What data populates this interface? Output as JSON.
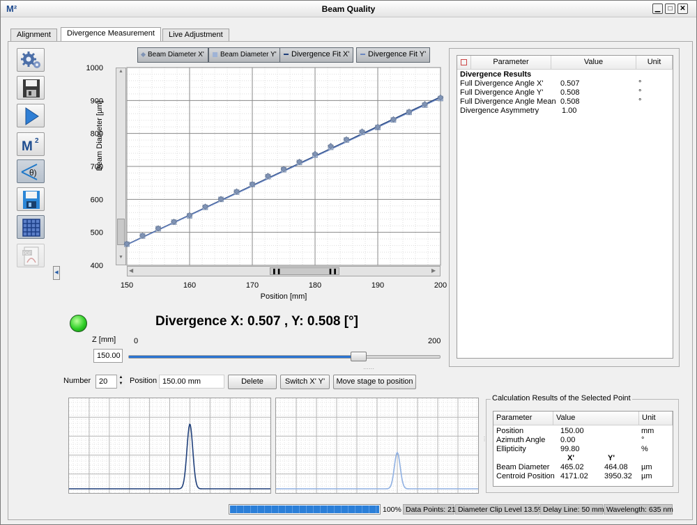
{
  "window": {
    "app_icon": "M²",
    "title": "Beam Quality",
    "buttons": [
      "minimize",
      "maximize",
      "close"
    ]
  },
  "tabs": [
    {
      "label": "Alignment",
      "active": false
    },
    {
      "label": "Divergence Measurement",
      "active": true
    },
    {
      "label": "Live Adjustment",
      "active": false
    }
  ],
  "toolbar": [
    {
      "icon": "settings-gear-icon"
    },
    {
      "icon": "load-disk-icon"
    },
    {
      "icon": "play-icon"
    },
    {
      "icon": "m2-icon",
      "label": "M²"
    },
    {
      "icon": "divergence-theta-icon",
      "label": "θ)",
      "pressed": true
    },
    {
      "icon": "save-disk-icon"
    },
    {
      "icon": "grid-table-icon",
      "pressed": true
    },
    {
      "icon": "pdf-export-icon",
      "label": "PDF",
      "disabled": true
    }
  ],
  "legend": [
    {
      "label": "Beam Diameter X'",
      "color": "#7f93b5",
      "marker": "diamond"
    },
    {
      "label": "Beam Diameter Y'",
      "color": "#9fb3d6",
      "marker": "square"
    },
    {
      "label": "Divergence Fit X'",
      "color": "#1f3f7a",
      "marker": "line"
    },
    {
      "label": "Divergence Fit Y'",
      "color": "#6b87c0",
      "marker": "line"
    }
  ],
  "chart_data": {
    "type": "scatter",
    "xlabel": "Position [mm]",
    "ylabel": "Beam Diameter [µm]",
    "xlim": [
      150,
      200
    ],
    "ylim": [
      400,
      1000
    ],
    "xticks": [
      150,
      160,
      170,
      180,
      190,
      200
    ],
    "yticks": [
      400,
      500,
      600,
      700,
      800,
      900,
      1000
    ],
    "grid": true,
    "series": [
      {
        "name": "Beam Diameter X'",
        "x": [
          150,
          152.5,
          155,
          157.5,
          160,
          162.5,
          165,
          167.5,
          170,
          172.5,
          175,
          177.5,
          180,
          182.5,
          185,
          187.5,
          190,
          192.5,
          195,
          197.5,
          200
        ],
        "values": [
          465,
          490,
          512,
          532,
          552,
          578,
          601,
          624,
          646,
          671,
          692,
          714,
          738,
          762,
          782,
          806,
          820,
          843,
          866,
          889,
          909
        ]
      },
      {
        "name": "Beam Diameter Y'",
        "x": [
          150,
          152.5,
          155,
          157.5,
          160,
          162.5,
          165,
          167.5,
          170,
          172.5,
          175,
          177.5,
          180,
          182.5,
          185,
          187.5,
          190,
          192.5,
          195,
          197.5,
          200
        ],
        "values": [
          464,
          489,
          511,
          531,
          550,
          576,
          600,
          622,
          645,
          669,
          690,
          712,
          734,
          758,
          780,
          803,
          818,
          841,
          864,
          886,
          906
        ]
      },
      {
        "name": "Divergence Fit X'",
        "x": [
          150,
          200
        ],
        "values": [
          463,
          911
        ]
      },
      {
        "name": "Divergence Fit Y'",
        "x": [
          150,
          200
        ],
        "values": [
          462,
          908
        ]
      }
    ]
  },
  "result_headline": "Divergence X: 0.507 , Y: 0.508 [°]",
  "status_led_color": "#2fcf27",
  "z_control": {
    "label": "Z [mm]",
    "value": "150.00",
    "min_label": "0",
    "max_label": "200",
    "fraction": 0.74
  },
  "results_table": {
    "headers": [
      "Parameter",
      "Value",
      "Unit"
    ],
    "section": "Divergence Results",
    "rows": [
      {
        "param": "Full Divergence Angle X'",
        "value": "0.507",
        "unit": "°"
      },
      {
        "param": "Full Divergence Angle Y'",
        "value": "0.508",
        "unit": "°"
      },
      {
        "param": "Full Divergence Angle Mean",
        "value": "0.508",
        "unit": "°"
      },
      {
        "param": "Divergence Asymmetry",
        "value": "1.00",
        "unit": ""
      }
    ]
  },
  "controls": {
    "number_label": "Number",
    "number_value": "20",
    "position_label": "Position",
    "position_value": "150.00 mm",
    "delete_label": "Delete",
    "switch_label": "Switch X' Y'",
    "move_label": "Move stage to position"
  },
  "profiles": [
    {
      "name": "X' profile",
      "color": "#1f3f7a",
      "peak_pos": 0.6,
      "peak_height": 0.75
    },
    {
      "name": "Y' profile",
      "color": "#8fb0e2",
      "peak_pos": 0.6,
      "peak_height": 0.42
    }
  ],
  "selected_point": {
    "group_title": "Calculation Results of the Selected Point",
    "headers": [
      "Parameter",
      "Value",
      "Unit"
    ],
    "rows": [
      {
        "param": "Position",
        "value": "150.00",
        "unit": "mm"
      },
      {
        "param": "Azimuth Angle",
        "value": "0.00",
        "unit": "°"
      },
      {
        "param": "Ellipticity",
        "value": "99.80",
        "unit": "%"
      }
    ],
    "xy_headers": [
      "X'",
      "Y'"
    ],
    "xy_rows": [
      {
        "param": "Beam Diameter",
        "x": "465.02",
        "y": "464.08",
        "unit": "µm"
      },
      {
        "param": "Centroid Position",
        "x": "4171.02",
        "y": "3950.32",
        "unit": "µm"
      }
    ]
  },
  "status": {
    "progress": 1.0,
    "progress_label": "100%",
    "data_points": "Data Points: 21",
    "clip_level": "Diameter Clip Level 13.5%",
    "delay_line": "Delay Line: 50 mm",
    "wavelength": "Wavelength: 635 nm"
  }
}
